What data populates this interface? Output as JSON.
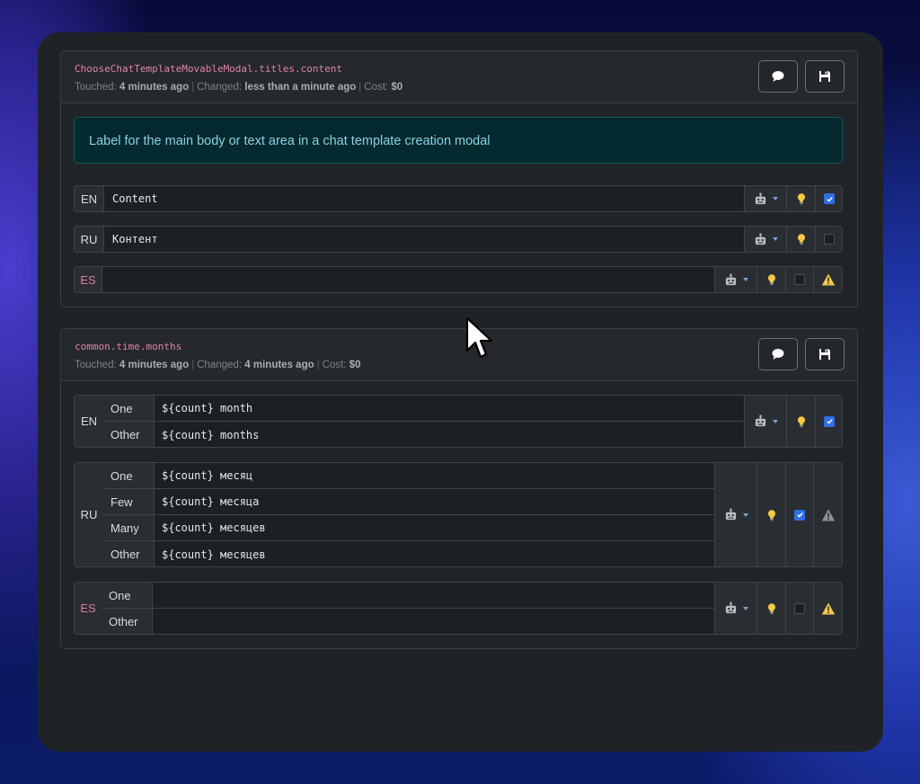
{
  "cards": [
    {
      "key": "ChooseChatTemplateMovableModal.titles.content",
      "meta": {
        "touched_label": "Touched:",
        "touched": "4 minutes ago",
        "changed_label": "Changed:",
        "changed": "less than a minute ago",
        "cost_label": "Cost:",
        "cost": "$0"
      },
      "description": "Label for the main body or text area in a chat template creation modal",
      "rows": [
        {
          "lang": "EN",
          "value": "Content",
          "checked": true,
          "warning": false
        },
        {
          "lang": "RU",
          "value": "Контент",
          "checked": false,
          "warning": false
        },
        {
          "lang": "ES",
          "value": "",
          "checked": false,
          "warning": true
        }
      ]
    },
    {
      "key": "common.time.months",
      "meta": {
        "touched_label": "Touched:",
        "touched": "4 minutes ago",
        "changed_label": "Changed:",
        "changed": "4 minutes ago",
        "cost_label": "Cost:",
        "cost": "$0"
      },
      "rows": [
        {
          "lang": "EN",
          "forms": [
            {
              "label": "One",
              "value": "${count} month"
            },
            {
              "label": "Other",
              "value": "${count} months"
            }
          ],
          "checked": true,
          "warning": false
        },
        {
          "lang": "RU",
          "forms": [
            {
              "label": "One",
              "value": "${count} месяц"
            },
            {
              "label": "Few",
              "value": "${count} месяца"
            },
            {
              "label": "Many",
              "value": "${count} месяцев"
            },
            {
              "label": "Other",
              "value": "${count} месяцев"
            }
          ],
          "checked": true,
          "warning": true
        },
        {
          "lang": "ES",
          "forms": [
            {
              "label": "One",
              "value": ""
            },
            {
              "label": "Other",
              "value": ""
            }
          ],
          "checked": false,
          "warning": true
        }
      ]
    }
  ],
  "icons": {
    "comment": "comment-icon",
    "save": "floppy-disk-icon",
    "robot": "robot-icon",
    "bulb": "lightbulb-icon",
    "warning": "warning-triangle-icon"
  },
  "colors": {
    "accent_key": "#e083a7",
    "info_bg": "#04292e",
    "info_text": "#8ad2df",
    "checkbox_on": "#2f6fe6",
    "warning_yellow": "#f2c94c"
  }
}
